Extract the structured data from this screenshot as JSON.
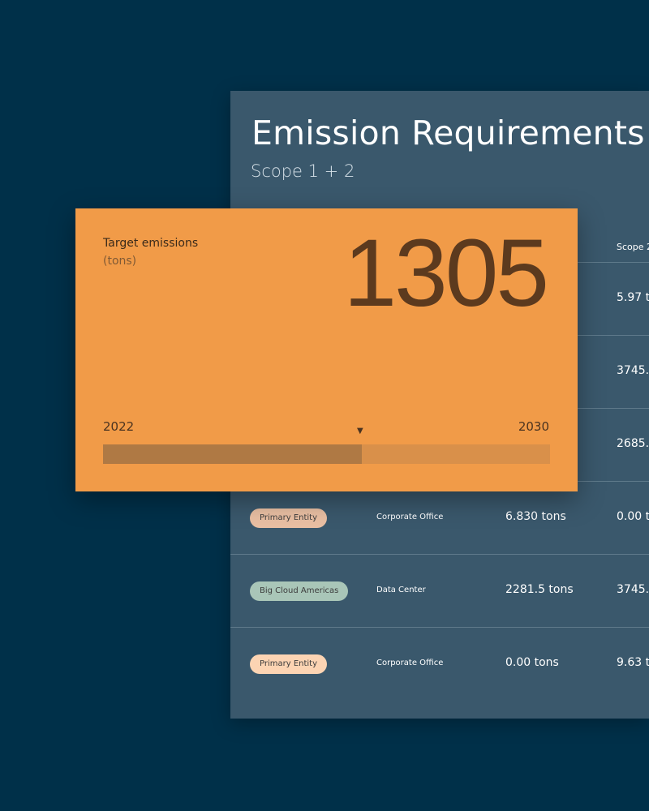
{
  "panel": {
    "title": "Emission Requirements",
    "subtitle": "Scope 1 + 2",
    "column_header": "Scope 2",
    "rows": [
      {
        "entity": "",
        "entity_color": "",
        "site": "",
        "scope1": "",
        "scope2": "5.97 t"
      },
      {
        "entity": "",
        "entity_color": "",
        "site": "",
        "scope1": "",
        "scope2": "3745.("
      },
      {
        "entity": "",
        "entity_color": "",
        "site": "",
        "scope1": "",
        "scope2": "2685."
      },
      {
        "entity": "Primary Entity",
        "entity_color": "#e9bfa3",
        "site": "Corporate Office",
        "scope1": "6.830 tons",
        "scope2": "0.00 t"
      },
      {
        "entity": "Big Cloud Americas",
        "entity_color": "#a9c6b8",
        "site": "Data Center",
        "scope1": "2281.5 tons",
        "scope2": "3745.("
      },
      {
        "entity": "Primary Entity",
        "entity_color": "#fcd4b3",
        "site": "Corporate Office",
        "scope1": "0.00 tons",
        "scope2": "9.63 t"
      }
    ]
  },
  "card": {
    "label": "Target emissions",
    "unit": "(tons)",
    "value": "1305",
    "start_year": "2022",
    "end_year": "2030",
    "progress_fraction": 0.579
  },
  "colors": {
    "background": "#003049",
    "panel": "#3a586c",
    "card": "#f19b48",
    "progress_fill": "#af7944",
    "progress_track": "#d9904a"
  }
}
